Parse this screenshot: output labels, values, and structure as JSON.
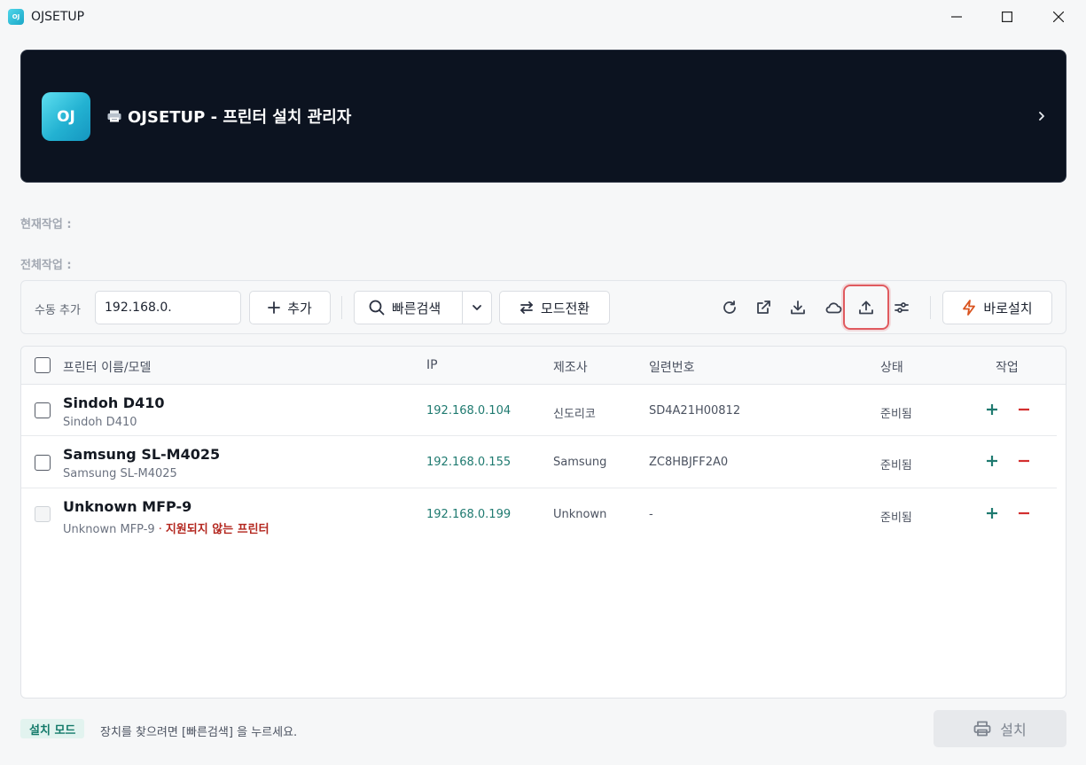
{
  "window": {
    "app_icon_text": "OJ",
    "title": "OJSETUP"
  },
  "banner": {
    "logo_text": "OJ",
    "title": "OJSETUP - 프린터 설치 관리자"
  },
  "status": {
    "current_label": "현재작업 :",
    "total_label": "전체작업 :"
  },
  "toolbar": {
    "manual_add_label": "수동 추가",
    "ip_input_value": "192.168.0.",
    "add_label": "추가",
    "quick_search_label": "빠른검색",
    "mode_switch_label": "모드전환",
    "direct_install_label": "바로설치",
    "icons": [
      "refresh-icon",
      "external-link-icon",
      "download-icon",
      "cloud-icon",
      "upload-icon",
      "sliders-icon"
    ]
  },
  "table": {
    "headers": {
      "name": "프린터 이름/모델",
      "ip": "IP",
      "maker": "제조사",
      "serial": "일련번호",
      "state": "상태",
      "action": "작업"
    },
    "rows": [
      {
        "name": "Sindoh D410",
        "model": "Sindoh D410",
        "warning": "",
        "ip": "192.168.0.104",
        "maker": "신도리코",
        "serial": "SD4A21H00812",
        "state": "준비됨"
      },
      {
        "name": "Samsung SL-M4025",
        "model": "Samsung SL-M4025",
        "warning": "",
        "ip": "192.168.0.155",
        "maker": "Samsung",
        "serial": "ZC8HBJFF2A0",
        "state": "준비됨"
      },
      {
        "name": "Unknown MFP-9",
        "model": "Unknown MFP-9",
        "separator": "·",
        "warning": "지원되지 않는 프린터",
        "ip": "192.168.0.199",
        "maker": "Unknown",
        "serial": "-",
        "state": "준비됨"
      }
    ]
  },
  "footer": {
    "mode_badge": "설치 모드",
    "message": "장치를 찾으려면 [빠른검색] 을 누르세요.",
    "install_label": "설치"
  },
  "colors": {
    "banner_bg": "#0c1320",
    "accent_teal": "#1f7a70",
    "danger_red": "#d32f2f",
    "highlight_red": "#e05a5f"
  }
}
